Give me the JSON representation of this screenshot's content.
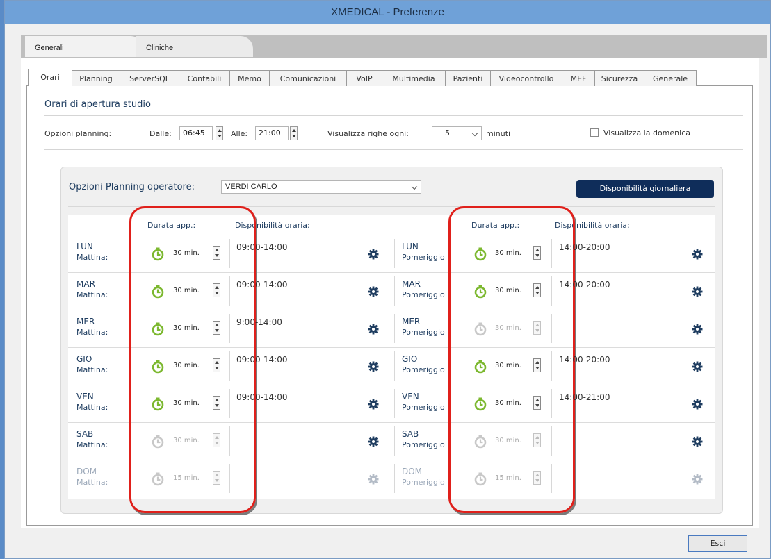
{
  "window": {
    "title": "XMEDICAL - Preferenze"
  },
  "outer_tabs": [
    {
      "label": "Generali",
      "active": true
    },
    {
      "label": "Cliniche",
      "active": false
    }
  ],
  "inner_tabs": [
    {
      "label": "Orari",
      "active": true
    },
    {
      "label": "Planning"
    },
    {
      "label": "ServerSQL"
    },
    {
      "label": "Contabili"
    },
    {
      "label": "Memo"
    },
    {
      "label": "Comunicazioni"
    },
    {
      "label": "VoIP"
    },
    {
      "label": "Multimedia"
    },
    {
      "label": "Pazienti"
    },
    {
      "label": "Videocontrollo"
    },
    {
      "label": "MEF"
    },
    {
      "label": "Sicurezza"
    },
    {
      "label": "Generale"
    }
  ],
  "studio": {
    "title": "Orari di apertura studio",
    "options_label": "Opzioni planning:",
    "from_label": "Dalle:",
    "from_value": "06:45",
    "to_label": "Alle:",
    "to_value": "21:00",
    "rows_label": "Visualizza righe ogni:",
    "rows_value": "5",
    "rows_unit": "minuti",
    "sunday_label": "Visualizza la domenica",
    "sunday_checked": false
  },
  "operator": {
    "label": "Opzioni Planning operatore:",
    "value": "VERDI CARLO",
    "daily_button": "Disponibilità giornaliera"
  },
  "columns": {
    "duration": "Durata app.:",
    "availability": "Disponibilità oraria:"
  },
  "days": [
    {
      "day": "LUN",
      "am": {
        "label": "Mattina:",
        "dur": "30 min.",
        "enabled": true,
        "avail": "09:00-14:00"
      },
      "pm": {
        "label": "Pomeriggio:",
        "dur": "30 min.",
        "enabled": true,
        "avail": "14:00-20:00"
      },
      "disabled": false
    },
    {
      "day": "MAR",
      "am": {
        "label": "Mattina:",
        "dur": "30 min.",
        "enabled": true,
        "avail": "09:00-14:00"
      },
      "pm": {
        "label": "Pomeriggio:",
        "dur": "30 min.",
        "enabled": true,
        "avail": "14:00-20:00"
      },
      "disabled": false
    },
    {
      "day": "MER",
      "am": {
        "label": "Mattina:",
        "dur": "30 min.",
        "enabled": true,
        "avail": "9:00-14:00"
      },
      "pm": {
        "label": "Pomeriggio:",
        "dur": "30 min.",
        "enabled": false,
        "avail": ""
      },
      "disabled": false
    },
    {
      "day": "GIO",
      "am": {
        "label": "Mattina:",
        "dur": "30 min.",
        "enabled": true,
        "avail": "09:00-14:00"
      },
      "pm": {
        "label": "Pomeriggio:",
        "dur": "30 min.",
        "enabled": true,
        "avail": "14:00-20:00"
      },
      "disabled": false
    },
    {
      "day": "VEN",
      "am": {
        "label": "Mattina:",
        "dur": "30 min.",
        "enabled": true,
        "avail": "09:00-14:00"
      },
      "pm": {
        "label": "Pomeriggio:",
        "dur": "30 min.",
        "enabled": true,
        "avail": "14:00-21:00"
      },
      "disabled": false
    },
    {
      "day": "SAB",
      "am": {
        "label": "Mattina:",
        "dur": "30 min.",
        "enabled": false,
        "avail": ""
      },
      "pm": {
        "label": "Pomeriggio:",
        "dur": "30 min.",
        "enabled": false,
        "avail": ""
      },
      "disabled": false
    },
    {
      "day": "DOM",
      "am": {
        "label": "Mattina:",
        "dur": "15 min.",
        "enabled": false,
        "avail": ""
      },
      "pm": {
        "label": "Pomeriggio:",
        "dur": "15 min.",
        "enabled": false,
        "avail": ""
      },
      "disabled": true
    }
  ],
  "footer": {
    "exit_button": "Esci"
  },
  "colors": {
    "accent_dark": "#0f2d5a",
    "timer_green": "#7cb82f",
    "highlight_red": "#e0201b",
    "label_blue": "#1f3d60"
  },
  "icons": {
    "timer": "stopwatch-icon",
    "gear": "gear-icon",
    "chevron": "chevron-down-icon"
  }
}
